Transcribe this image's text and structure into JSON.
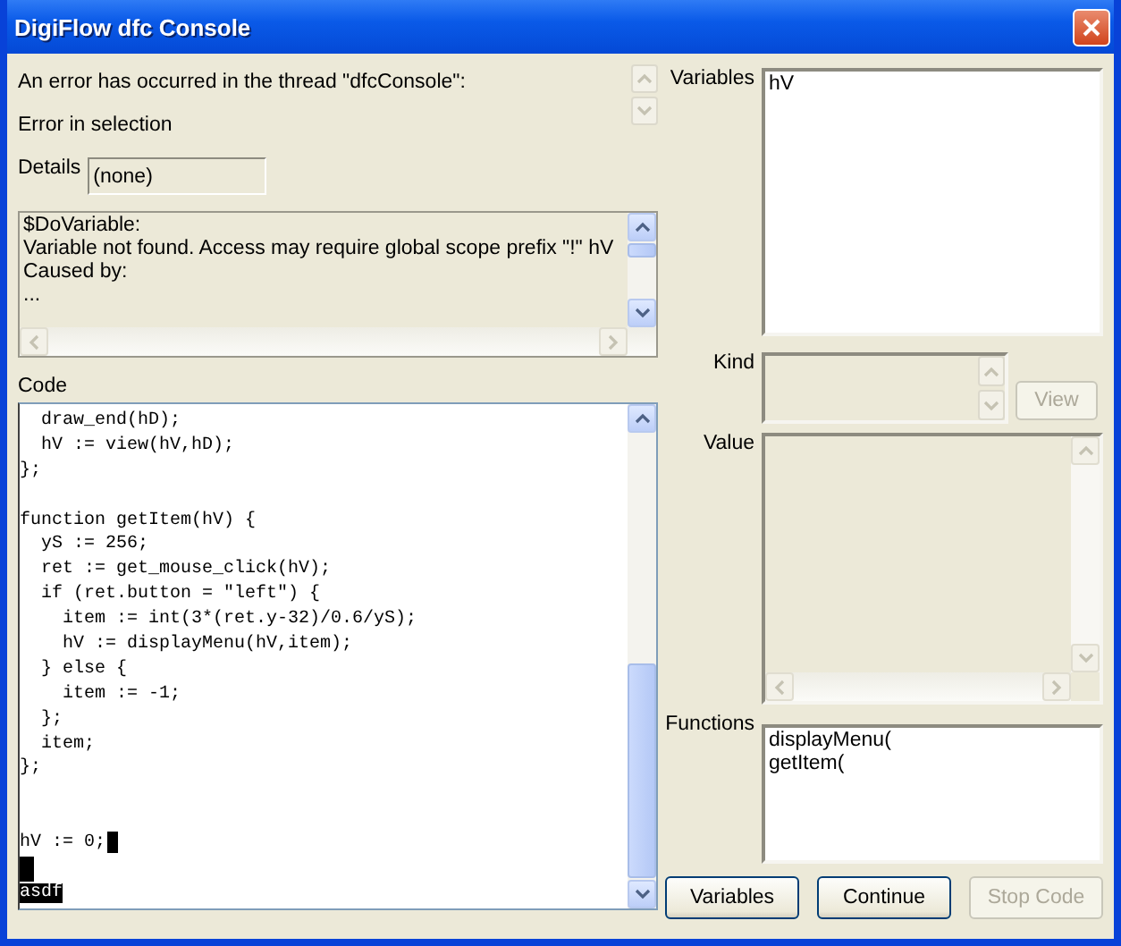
{
  "window": {
    "title": "DigiFlow dfc Console"
  },
  "message": {
    "heading": "An error has occurred in the thread \"dfcConsole\":",
    "error": "Error in selection"
  },
  "details": {
    "label": "Details",
    "value": "(none)"
  },
  "error_text": [
    "$DoVariable:",
    "Variable not found. Access may require global scope prefix \"!\" hV",
    "Caused by:",
    "..."
  ],
  "code": {
    "label": "Code",
    "lines": [
      {
        "text": "  draw_end(hD);",
        "selected": false,
        "newline_selected": false
      },
      {
        "text": "  hV := view(hV,hD);",
        "selected": false,
        "newline_selected": false
      },
      {
        "text": "};",
        "selected": false,
        "newline_selected": false
      },
      {
        "newline_selected": false
      },
      {
        "text": "function getItem(hV) {",
        "selected": false,
        "newline_selected": false
      },
      {
        "text": "  yS := 256;",
        "selected": false,
        "newline_selected": false
      },
      {
        "text": "  ret := get_mouse_click(hV);",
        "selected": false,
        "newline_selected": false
      },
      {
        "text": "  if (ret.button = \"left\") {",
        "selected": false,
        "newline_selected": false
      },
      {
        "text": "    item := int(3*(ret.y-32)/0.6/yS);",
        "selected": false,
        "newline_selected": false
      },
      {
        "text": "    hV := displayMenu(hV,item);",
        "selected": false,
        "newline_selected": false
      },
      {
        "text": "  } else {",
        "selected": false,
        "newline_selected": false
      },
      {
        "text": "    item := -1;",
        "selected": false,
        "newline_selected": false
      },
      {
        "text": "  };",
        "selected": false,
        "newline_selected": false
      },
      {
        "text": "  item;",
        "selected": false,
        "newline_selected": false
      },
      {
        "text": "};",
        "selected": false,
        "newline_selected": false
      },
      {
        "newline_selected": false
      },
      {
        "newline_selected": false
      },
      {
        "text": "hV := 0;",
        "selected": false,
        "newline_selected": true
      },
      {
        "newline_selected": true
      },
      {
        "text": "asdf",
        "selected": true,
        "newline_selected": false
      }
    ]
  },
  "variables": {
    "label": "Variables",
    "items": [
      "hV"
    ]
  },
  "kind": {
    "label": "Kind"
  },
  "view_button": {
    "label": "View",
    "disabled": true
  },
  "value": {
    "label": "Value"
  },
  "functions": {
    "label": "Functions",
    "items": [
      "displayMenu(",
      "getItem("
    ]
  },
  "buttons": [
    {
      "label": "Variables",
      "disabled": false
    },
    {
      "label": "Continue",
      "disabled": false
    },
    {
      "label": "Stop Code",
      "disabled": true
    }
  ]
}
